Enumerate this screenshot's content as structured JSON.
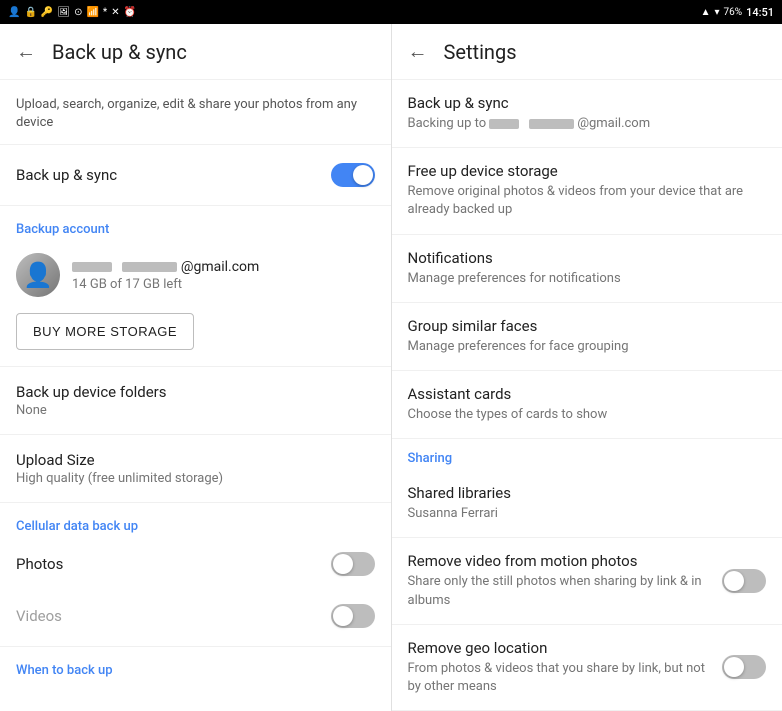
{
  "statusBar": {
    "battery": "76%",
    "time": "14:51",
    "icons": [
      "person",
      "lock",
      "vpn",
      "image",
      "circle",
      "wifi",
      "bluetooth",
      "x-circle",
      "alarm",
      "wifi-signal",
      "triangle"
    ]
  },
  "leftScreen": {
    "title": "Back up & sync",
    "backIcon": "←",
    "description": "Upload, search, organize, edit & share your photos from any device",
    "backupSyncLabel": "Back up & sync",
    "backupSyncEnabled": true,
    "backupAccountLabel": "Backup account",
    "accountEmail": "@gmail.com",
    "accountStorage": "14 GB of 17 GB left",
    "buyStorageButton": "BUY MORE STORAGE",
    "backupFoldersLabel": "Back up device folders",
    "backupFoldersValue": "None",
    "uploadSizeLabel": "Upload Size",
    "uploadSizeValue": "High quality (free unlimited storage)",
    "cellularDataLabel": "Cellular data back up",
    "photosLabel": "Photos",
    "photosEnabled": false,
    "videosLabel": "Videos",
    "videosEnabled": false,
    "whenToBackupLabel": "When to back up"
  },
  "rightScreen": {
    "title": "Settings",
    "backIcon": "←",
    "items": [
      {
        "id": "backup-sync",
        "title": "Back up & sync",
        "desc": "Backing up to",
        "email": "@gmail.com",
        "hasToggle": false
      },
      {
        "id": "free-up-storage",
        "title": "Free up device storage",
        "desc": "Remove original photos & videos from your device that are already backed up",
        "hasToggle": false
      },
      {
        "id": "notifications",
        "title": "Notifications",
        "desc": "Manage preferences for notifications",
        "hasToggle": false
      },
      {
        "id": "group-faces",
        "title": "Group similar faces",
        "desc": "Manage preferences for face grouping",
        "hasToggle": false
      },
      {
        "id": "assistant-cards",
        "title": "Assistant cards",
        "desc": "Choose the types of cards to show",
        "hasToggle": false
      }
    ],
    "sharingLabel": "Sharing",
    "sharingItems": [
      {
        "id": "shared-libraries",
        "title": "Shared libraries",
        "desc": "Susanna Ferrari",
        "hasToggle": false
      },
      {
        "id": "remove-video-motion",
        "title": "Remove video from motion photos",
        "desc": "Share only the still photos when sharing by link & in albums",
        "hasToggle": true,
        "toggleEnabled": false
      },
      {
        "id": "remove-geo-location",
        "title": "Remove geo location",
        "desc": "From photos & videos that you share by link, but not by other means",
        "hasToggle": true,
        "toggleEnabled": false
      }
    ]
  }
}
